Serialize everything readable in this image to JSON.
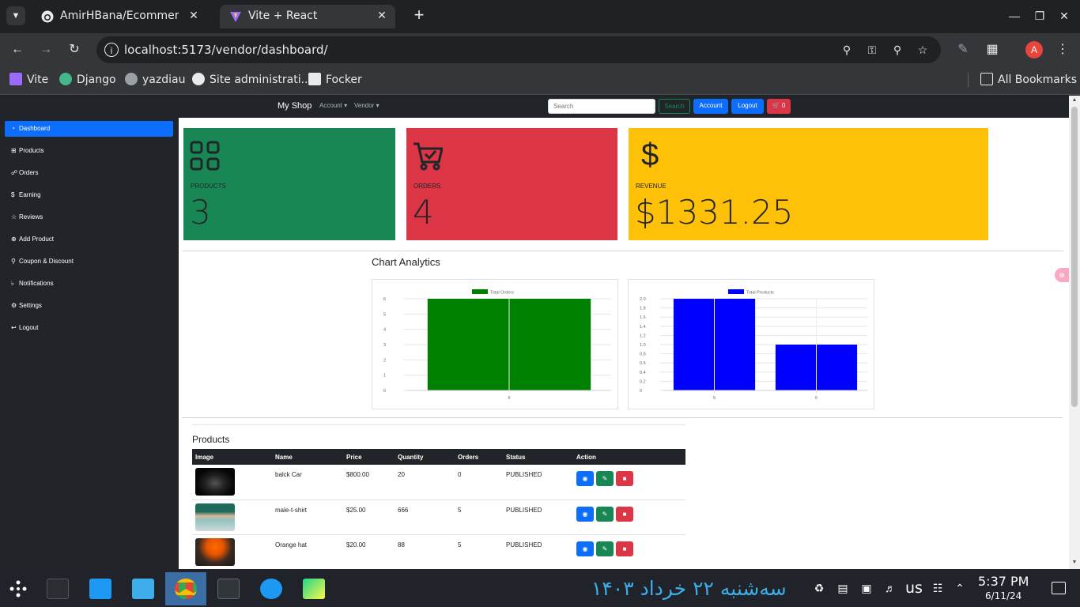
{
  "browser": {
    "tabs": [
      {
        "title": "AmirHBana/Ecommerce-Store",
        "icon": "github-icon",
        "active": false
      },
      {
        "title": "Vite + React",
        "icon": "vite-icon",
        "active": true
      }
    ],
    "url": "localhost:5173/vendor/dashboard/",
    "bookmarks": [
      {
        "label": "Vite",
        "icon": "vite-icon"
      },
      {
        "label": "Django",
        "icon": "django-icon"
      },
      {
        "label": "yazdiau",
        "icon": "globe-icon"
      },
      {
        "label": "Site administrati...",
        "icon": "django-admin-icon"
      },
      {
        "label": "Focker",
        "icon": "focker-icon"
      }
    ],
    "all_bookmarks": "All Bookmarks",
    "avatar_letter": "A"
  },
  "navbar": {
    "brand": "My Shop",
    "account": "Account",
    "vendor": "Vendor",
    "search_placeholder": "Search",
    "search_btn": "Search",
    "account_btn": "Account",
    "logout_btn": "Logout",
    "cart_count": "0"
  },
  "sidebar": {
    "items": [
      {
        "label": "Dashboard",
        "icon": "speedometer-icon",
        "active": true
      },
      {
        "label": "Products",
        "icon": "grid-icon",
        "active": false
      },
      {
        "label": "Orders",
        "icon": "cart-icon",
        "active": false
      },
      {
        "label": "Earning",
        "icon": "dollar-icon",
        "active": false
      },
      {
        "label": "Reviews",
        "icon": "star-icon",
        "active": false
      },
      {
        "label": "Add Product",
        "icon": "plus-circle-icon",
        "active": false
      },
      {
        "label": "Coupon & Discount",
        "icon": "tag-icon",
        "active": false
      },
      {
        "label": "Notifications",
        "icon": "bell-icon",
        "active": false
      },
      {
        "label": "Settings",
        "icon": "gear-icon",
        "active": false
      },
      {
        "label": "Logout",
        "icon": "logout-icon",
        "active": false
      }
    ]
  },
  "cards": [
    {
      "label": "PRODUCTS",
      "value": "3",
      "color": "#198754",
      "icon": "grid-icon"
    },
    {
      "label": "ORDERS",
      "value": "4",
      "color": "#dc3545",
      "icon": "cart-check-icon"
    },
    {
      "label": "REVENUE",
      "value": "$1331.25",
      "color": "#ffc107",
      "icon": "dollar-icon"
    }
  ],
  "analytics_title": "Chart Analytics",
  "chart_data": [
    {
      "type": "bar",
      "categories": [
        "6"
      ],
      "series": [
        {
          "name": "Total Orders",
          "values": [
            6
          ],
          "color": "#008000"
        }
      ],
      "ylim": [
        0,
        6
      ],
      "yticks": [
        "0",
        "1",
        "2",
        "3",
        "4",
        "5",
        "6"
      ],
      "grid": true,
      "legend": "top-center"
    },
    {
      "type": "bar",
      "categories": [
        "5",
        "6"
      ],
      "series": [
        {
          "name": "Total Products",
          "values": [
            2,
            1
          ],
          "color": "#0000ff"
        }
      ],
      "ylim": [
        0,
        2
      ],
      "yticks": [
        "0",
        "0.2",
        "0.4",
        "0.6",
        "0.8",
        "1.0",
        "1.2",
        "1.4",
        "1.6",
        "1.8",
        "2.0"
      ],
      "grid": true,
      "legend": "top-center"
    }
  ],
  "products": {
    "title": "Products",
    "columns": [
      "Image",
      "Name",
      "Price",
      "Quantity",
      "Orders",
      "Status",
      "Action"
    ],
    "rows": [
      {
        "name": "balck Car",
        "price": "$800.00",
        "quantity": "20",
        "orders": "0",
        "status": "PUBLISHED",
        "thumb": "#111111"
      },
      {
        "name": "male-t-shirt",
        "price": "$25.00",
        "quantity": "666",
        "orders": "5",
        "status": "PUBLISHED",
        "thumb": "#7fb7b4"
      },
      {
        "name": "Orange hat",
        "price": "$20.00",
        "quantity": "88",
        "orders": "5",
        "status": "PUBLISHED",
        "thumb": "#2c2c2c"
      }
    ]
  },
  "taskbar": {
    "date_persian": "سه‌شنبه ۲۲ خرداد ۱۴۰۳",
    "lang": "us",
    "time": "5:37 PM",
    "date": "6/11/24"
  }
}
